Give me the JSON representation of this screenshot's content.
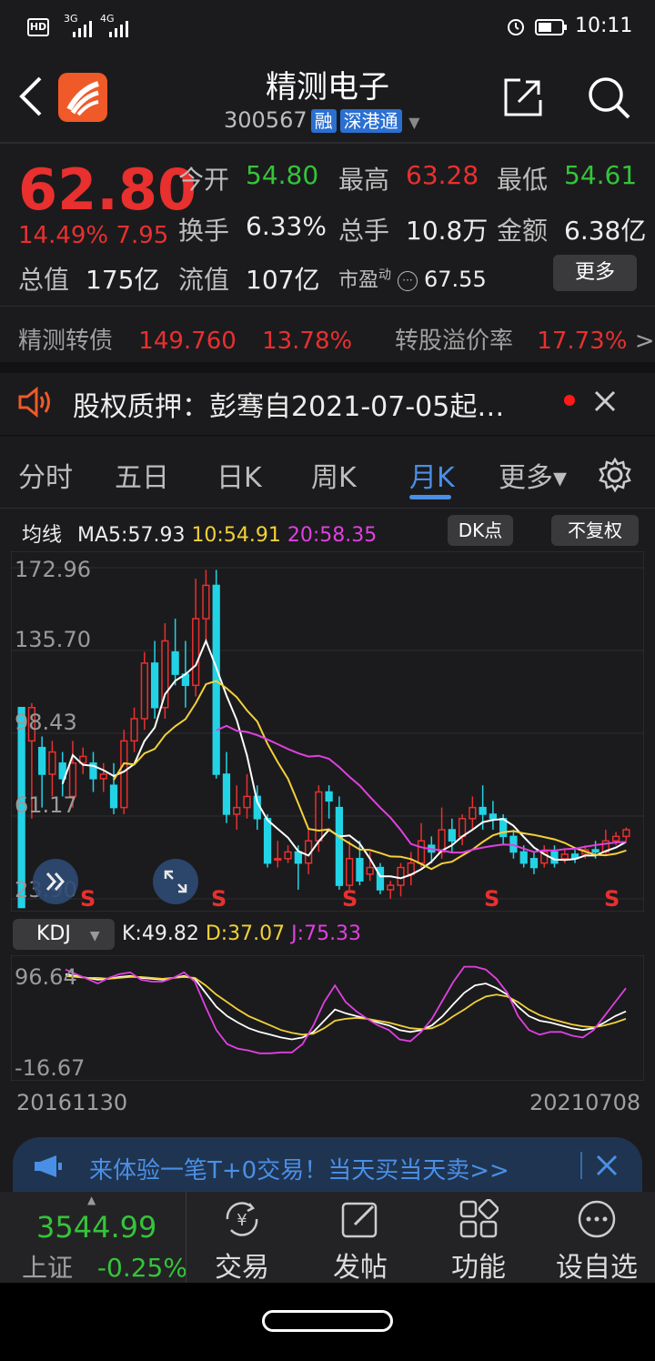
{
  "status": {
    "time": "10:11",
    "signal1": "HD",
    "net1": "3G",
    "net2": "4G"
  },
  "header": {
    "title": "精测电子",
    "code": "300567",
    "tag_rong": "融",
    "tag_sgt": "深港通"
  },
  "quote": {
    "price": "62.80",
    "change_pct": "14.49%",
    "change_amt": "7.95",
    "open_label": "今开",
    "open": "54.80",
    "high_label": "最高",
    "high": "63.28",
    "low_label": "最低",
    "low": "54.61",
    "turnover_label": "换手",
    "turnover": "6.33%",
    "volume_label": "总手",
    "volume": "10.8万",
    "amount_label": "金额",
    "amount": "6.38亿",
    "mktcap_label": "总值",
    "mktcap": "175亿",
    "float_label": "流值",
    "float": "107亿",
    "pe_label": "市盈",
    "pe_sup": "动",
    "pe": "67.55",
    "more_label": "更多"
  },
  "bond": {
    "name": "精测转债",
    "price": "149.760",
    "pct": "13.78%",
    "premium_label": "转股溢价率",
    "premium": "17.73%",
    "arrow": ">"
  },
  "notice": {
    "text": "股权质押：彭骞自2021-07-05起…"
  },
  "tabs": [
    {
      "label": "分时"
    },
    {
      "label": "五日"
    },
    {
      "label": "日K"
    },
    {
      "label": "周K"
    },
    {
      "label": "月K"
    },
    {
      "label": "更多▾"
    }
  ],
  "ma": {
    "label": "均线",
    "ma5": "MA5:57.93",
    "ma10": "10:54.91",
    "ma20": "20:58.35",
    "dk_label": "DK点",
    "fq_label": "不复权"
  },
  "chart_data": [
    {
      "type": "candlestick",
      "title": "",
      "y_ticks": [
        "172.96",
        "135.70",
        "98.43",
        "61.17",
        "23.90"
      ],
      "ylim": [
        23.9,
        172.96
      ],
      "markers": [
        "S",
        "S",
        "S",
        "S",
        "S"
      ],
      "start_date": "20161130",
      "end_date": "20210708",
      "candles": [
        [
          110,
          20,
          110,
          23.9
        ],
        [
          95,
          110,
          112,
          60
        ],
        [
          92,
          80,
          97,
          65
        ],
        [
          80,
          90,
          95,
          70
        ],
        [
          85,
          78,
          90,
          70
        ],
        [
          70,
          85,
          95,
          65
        ],
        [
          85,
          88,
          92,
          80
        ],
        [
          85,
          78,
          90,
          72
        ],
        [
          78,
          80,
          85,
          72
        ],
        [
          75,
          65,
          85,
          62
        ],
        [
          65,
          95,
          100,
          62
        ],
        [
          95,
          105,
          110,
          90
        ],
        [
          105,
          130,
          135,
          100
        ],
        [
          130,
          110,
          140,
          105
        ],
        [
          110,
          140,
          148,
          105
        ],
        [
          135,
          125,
          150,
          120
        ],
        [
          125,
          120,
          140,
          110
        ],
        [
          120,
          150,
          168,
          115
        ],
        [
          150,
          165,
          172,
          140
        ],
        [
          165,
          80,
          172,
          78
        ],
        [
          80,
          62,
          90,
          58
        ],
        [
          62,
          65,
          75,
          55
        ],
        [
          65,
          70,
          80,
          60
        ],
        [
          70,
          60,
          75,
          55
        ],
        [
          60,
          40,
          62,
          38
        ],
        [
          42,
          42,
          50,
          38
        ],
        [
          42,
          45,
          48,
          40
        ],
        [
          45,
          40,
          48,
          28
        ],
        [
          40,
          50,
          55,
          35
        ],
        [
          50,
          72,
          75,
          45
        ],
        [
          72,
          68,
          75,
          60
        ],
        [
          65,
          30,
          70,
          28
        ],
        [
          30,
          42,
          50,
          28
        ],
        [
          42,
          32,
          50,
          30
        ],
        [
          35,
          38,
          45,
          32
        ],
        [
          38,
          28,
          40,
          26
        ],
        [
          28,
          30,
          32,
          24
        ],
        [
          30,
          38,
          40,
          25
        ],
        [
          35,
          40,
          45,
          30
        ],
        [
          40,
          50,
          58,
          38
        ],
        [
          48,
          45,
          52,
          40
        ],
        [
          45,
          55,
          65,
          42
        ],
        [
          55,
          50,
          60,
          45
        ],
        [
          52,
          60,
          62,
          48
        ],
        [
          60,
          65,
          70,
          55
        ],
        [
          65,
          62,
          75,
          55
        ],
        [
          62,
          60,
          68,
          55
        ],
        [
          60,
          52,
          62,
          48
        ],
        [
          52,
          45,
          55,
          42
        ],
        [
          45,
          40,
          48,
          38
        ],
        [
          42,
          38,
          45,
          35
        ],
        [
          40,
          45,
          48,
          38
        ],
        [
          45,
          40,
          48,
          38
        ],
        [
          42,
          44,
          46,
          40
        ],
        [
          44,
          42,
          46,
          40
        ],
        [
          44,
          46,
          48,
          42
        ],
        [
          46,
          45,
          50,
          42
        ],
        [
          45,
          50,
          55,
          44
        ],
        [
          50,
          52,
          54,
          48
        ],
        [
          52,
          55,
          56,
          50
        ]
      ],
      "series": [
        {
          "name": "MA5"
        },
        {
          "name": "10"
        },
        {
          "name": "20"
        }
      ]
    },
    {
      "type": "line",
      "title": "",
      "indicator_label": "KDJ",
      "k": "K:49.82",
      "d": "D:37.07",
      "j": "J:75.33",
      "y_ticks": [
        "96.64",
        "-16.67"
      ],
      "ylim": [
        -16.67,
        96.64
      ],
      "series": [
        {
          "name": "K",
          "values": [
            90,
            88,
            86,
            84,
            85,
            87,
            88,
            86,
            85,
            84,
            86,
            88,
            85,
            70,
            55,
            45,
            38,
            32,
            28,
            25,
            22,
            20,
            22,
            28,
            40,
            52,
            48,
            45,
            42,
            38,
            35,
            30,
            28,
            30,
            35,
            45,
            58,
            70,
            78,
            80,
            75,
            68,
            55,
            45,
            40,
            38,
            35,
            32,
            30,
            32,
            38,
            45,
            50
          ]
        },
        {
          "name": "D",
          "values": [
            88,
            87,
            86,
            86,
            85,
            86,
            87,
            87,
            86,
            85,
            86,
            87,
            86,
            78,
            68,
            60,
            52,
            45,
            40,
            35,
            30,
            27,
            25,
            26,
            32,
            40,
            42,
            43,
            42,
            40,
            38,
            35,
            32,
            31,
            32,
            37,
            45,
            52,
            60,
            66,
            68,
            66,
            60,
            52,
            46,
            42,
            39,
            36,
            34,
            33,
            35,
            38,
            42
          ]
        },
        {
          "name": "J",
          "values": [
            95,
            90,
            85,
            80,
            86,
            90,
            92,
            84,
            82,
            82,
            86,
            92,
            82,
            55,
            30,
            15,
            10,
            8,
            5,
            5,
            6,
            6,
            15,
            35,
            60,
            78,
            60,
            50,
            42,
            35,
            30,
            20,
            18,
            28,
            42,
            62,
            82,
            98,
            98,
            95,
            85,
            70,
            45,
            30,
            25,
            28,
            28,
            24,
            22,
            30,
            45,
            60,
            75
          ]
        }
      ]
    }
  ],
  "kdj": {
    "label": "KDJ",
    "k": "K:49.82",
    "d": "D:37.07",
    "j": "J:75.33"
  },
  "dates": {
    "start": "20161130",
    "end": "20210708"
  },
  "ad": {
    "text": "来体验一笔T+0交易！当天买当天卖>>"
  },
  "index": {
    "value": "3544.99",
    "name": "上证",
    "pct": "-0.25%"
  },
  "bottom": [
    {
      "label": "交易"
    },
    {
      "label": "发帖"
    },
    {
      "label": "功能"
    },
    {
      "label": "设自选"
    }
  ],
  "colors": {
    "up": "#e8302f",
    "down": "#22d3e6",
    "ma5": "#ffffff",
    "ma10": "#f2d13a",
    "ma20": "#e040e0",
    "accent": "#4a8fe6"
  }
}
